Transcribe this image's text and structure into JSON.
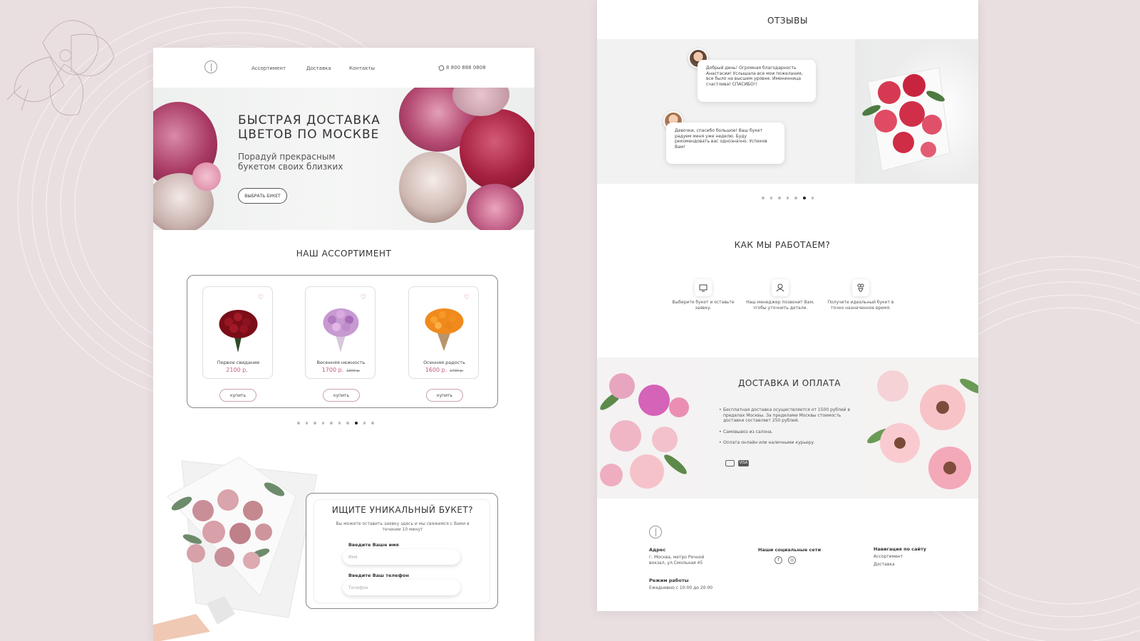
{
  "colors": {
    "background": "#e9dfe1",
    "accent": "#c25a78",
    "text": "#333333"
  },
  "left_page": {
    "nav": {
      "logo_icon": "leaf-logo-icon",
      "links": [
        "Ассортимент",
        "Доставка",
        "Контакты"
      ],
      "phone": "8 800 888 0808",
      "phone_icon": "phone-icon"
    },
    "hero": {
      "title_line1": "БЫСТРАЯ ДОСТАВКА",
      "title_line2": "ЦВЕТОВ ПО МОСКВЕ",
      "subtitle_line1": "Порадуй прекрасным",
      "subtitle_line2": "букетом своих близких",
      "button": "ВЫБРАТЬ БУКЕТ"
    },
    "assortment": {
      "title": "НАШ АССОРТИМЕНТ",
      "products": [
        {
          "name": "Первое свидание",
          "price": "2100 р.",
          "old_price": "",
          "buy": "купить"
        },
        {
          "name": "Весенняя нежность",
          "price": "1700 р.",
          "old_price": "1900 р.",
          "buy": "купить"
        },
        {
          "name": "Осенняя радость",
          "price": "1600 р.",
          "old_price": "1700 р.",
          "buy": "купить"
        }
      ],
      "dots_count": 10,
      "active_dot": 7
    },
    "request": {
      "title": "ИЩИТЕ УНИКАЛЬНЫЙ БУКЕТ?",
      "text": "Вы можете оставить заявку здесь и мы свяжемся с Вами в течении 10 минут",
      "name_label": "Введите Ваше имя",
      "name_placeholder": "Имя",
      "phone_label": "Введите Ваш телефон",
      "phone_placeholder": "Телефон"
    }
  },
  "right_page": {
    "reviews": {
      "title": "ОТЗЫВЫ",
      "items": [
        {
          "text": "Добрый день! Огромная благодарность Анастасии! Услышала все мои пожелания, все было на высшем уровне. Именинница счастлива! СПАСИБО!!"
        },
        {
          "text": "Девочки, спасибо большое! Ваш букет радуем меня уже неделю. Буду рекомендовать вас однозначно. Успехов Вам!"
        }
      ],
      "dots_count": 7,
      "active_dot": 5
    },
    "how": {
      "title": "КАК МЫ РАБОТАЕМ?",
      "steps": [
        {
          "icon": "monitor-icon",
          "text": "Выберите букет и оставьте заявку."
        },
        {
          "icon": "manager-icon",
          "text": "Наш менеджер позвонит Вам, чтобы уточнить детали."
        },
        {
          "icon": "bouquet-icon",
          "text": "Получите идеальный букет в точно назначенное время."
        }
      ]
    },
    "delivery": {
      "title": "ДОСТАВКА И ОПЛАТА",
      "items": [
        "Бесплатная доставка осуществляется от 1500 рублей в пределах Москвы. За пределами Москвы стоимость доставки составляет 250 рублей.",
        "Самовывоз из салона.",
        "Оплата онлайн или наличными курьеру."
      ],
      "payment_icons": [
        "card-icon",
        "VISA"
      ]
    },
    "footer": {
      "address_label": "Адрес",
      "address_line1": "г. Москва, метро Речной",
      "address_line2": "вокзал, ул.Смольная 45",
      "hours_label": "Режим работы",
      "hours": "Ежедневно с 10:00 до 20:00",
      "social_label": "Наши социальные сети",
      "social_icons": [
        "facebook-icon",
        "instagram-icon"
      ],
      "nav_label": "Навигация по сайту",
      "nav_links": [
        "Ассортимент",
        "Доставка"
      ]
    }
  }
}
